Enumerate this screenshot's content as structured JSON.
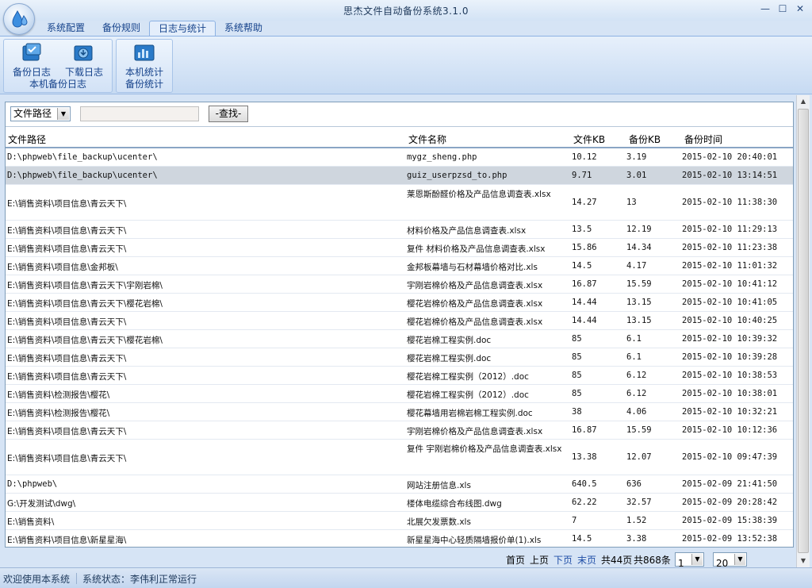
{
  "window": {
    "title": "思杰文件自动备份系统3.1.0",
    "minimize": "—",
    "maximize": "☐",
    "close": "✕"
  },
  "tabs": [
    "系统配置",
    "备份规则",
    "日志与统计",
    "系统帮助"
  ],
  "ribbon": {
    "group1": {
      "caption": "本机备份日志",
      "backup_log": "备份日志",
      "download_log": "下载日志"
    },
    "group2": {
      "caption": "备份统计",
      "local_stats": "本机统计"
    }
  },
  "search": {
    "field_select": "文件路径",
    "input_value": "",
    "button": "-查找-"
  },
  "columns": {
    "path": "文件路径",
    "name": "文件名称",
    "size": "文件KB",
    "backup_size": "备份KB",
    "time": "备份时间"
  },
  "rows": [
    {
      "path": "D:\\phpweb\\file_backup\\ucenter\\",
      "name": "mygz_sheng.php",
      "size": "10.12",
      "bsize": "3.19",
      "time": "2015-02-10 20:40:01"
    },
    {
      "path": "D:\\phpweb\\file_backup\\ucenter\\",
      "name": "guiz_userpzsd_to.php",
      "size": "9.71",
      "bsize": "3.01",
      "time": "2015-02-10 13:14:51"
    },
    {
      "path": "E:\\销售资料\\项目信息\\青云天下\\",
      "name": "莱恩斯酚醛价格及产品信息调查表.xlsx",
      "size": "14.27",
      "bsize": "13",
      "time": "2015-02-10 11:38:30"
    },
    {
      "path": "E:\\销售资料\\项目信息\\青云天下\\",
      "name": "材料价格及产品信息调查表.xlsx",
      "size": "13.5",
      "bsize": "12.19",
      "time": "2015-02-10 11:29:13"
    },
    {
      "path": "E:\\销售资料\\项目信息\\青云天下\\",
      "name": "复件 材料价格及产品信息调查表.xlsx",
      "size": "15.86",
      "bsize": "14.34",
      "time": "2015-02-10 11:23:38"
    },
    {
      "path": "E:\\销售资料\\项目信息\\金邦板\\",
      "name": "金邦板幕墙与石材幕墙价格对比.xls",
      "size": "14.5",
      "bsize": "4.17",
      "time": "2015-02-10 11:01:32"
    },
    {
      "path": "E:\\销售资料\\项目信息\\青云天下\\宇刚岩棉\\",
      "name": "宇刚岩棉价格及产品信息调查表.xlsx",
      "size": "16.87",
      "bsize": "15.59",
      "time": "2015-02-10 10:41:12"
    },
    {
      "path": "E:\\销售资料\\项目信息\\青云天下\\樱花岩棉\\",
      "name": "樱花岩棉价格及产品信息调查表.xlsx",
      "size": "14.44",
      "bsize": "13.15",
      "time": "2015-02-10 10:41:05"
    },
    {
      "path": "E:\\销售资料\\项目信息\\青云天下\\",
      "name": "樱花岩棉价格及产品信息调查表.xlsx",
      "size": "14.44",
      "bsize": "13.15",
      "time": "2015-02-10 10:40:25"
    },
    {
      "path": "E:\\销售资料\\项目信息\\青云天下\\樱花岩棉\\",
      "name": "樱花岩棉工程实例.doc",
      "size": "85",
      "bsize": "6.1",
      "time": "2015-02-10 10:39:32"
    },
    {
      "path": "E:\\销售资料\\项目信息\\青云天下\\",
      "name": "樱花岩棉工程实例.doc",
      "size": "85",
      "bsize": "6.1",
      "time": "2015-02-10 10:39:28"
    },
    {
      "path": "E:\\销售资料\\项目信息\\青云天下\\",
      "name": "樱花岩棉工程实例（2012）.doc",
      "size": "85",
      "bsize": "6.12",
      "time": "2015-02-10 10:38:53"
    },
    {
      "path": "E:\\销售资料\\检测报告\\樱花\\",
      "name": "樱花岩棉工程实例（2012）.doc",
      "size": "85",
      "bsize": "6.12",
      "time": "2015-02-10 10:38:01"
    },
    {
      "path": "E:\\销售资料\\检测报告\\樱花\\",
      "name": "樱花幕墙用岩棉岩棉工程实例.doc",
      "size": "38",
      "bsize": "4.06",
      "time": "2015-02-10 10:32:21"
    },
    {
      "path": "E:\\销售资料\\项目信息\\青云天下\\",
      "name": "宇刚岩棉价格及产品信息调查表.xlsx",
      "size": "16.87",
      "bsize": "15.59",
      "time": "2015-02-10 10:12:36"
    },
    {
      "path": "E:\\销售资料\\项目信息\\青云天下\\",
      "name": "复件 宇刚岩棉价格及产品信息调查表.xlsx",
      "size": "13.38",
      "bsize": "12.07",
      "time": "2015-02-10 09:47:39"
    },
    {
      "path": "D:\\phpweb\\",
      "name": "网站注册信息.xls",
      "size": "640.5",
      "bsize": "636",
      "time": "2015-02-09 21:41:50"
    },
    {
      "path": "G:\\开发测试\\dwg\\",
      "name": "楼体电缆综合布线图.dwg",
      "size": "62.22",
      "bsize": "32.57",
      "time": "2015-02-09 20:28:42"
    },
    {
      "path": "E:\\销售资料\\",
      "name": "北展欠发票数.xls",
      "size": "7",
      "bsize": "1.52",
      "time": "2015-02-09 15:38:39"
    },
    {
      "path": "E:\\销售资料\\项目信息\\新星星海\\",
      "name": "新星星海中心轻质隔墙报价单(1).xls",
      "size": "14.5",
      "bsize": "3.38",
      "time": "2015-02-09 13:52:38"
    }
  ],
  "pager": {
    "first": "首页",
    "prev": "上页",
    "next": "下页",
    "last": "末页",
    "total_pages": "共44页",
    "total_records": "共868条",
    "page_select": "1",
    "size_select": "20"
  },
  "statusbar": {
    "welcome": "欢迎使用本系统",
    "status": "系统状态：李伟利正常运行"
  },
  "colors": {
    "accent": "#15428b",
    "ribbon": "#d6e4f5",
    "selected_row": "#cfd6de",
    "link": "#1f4ea6"
  }
}
